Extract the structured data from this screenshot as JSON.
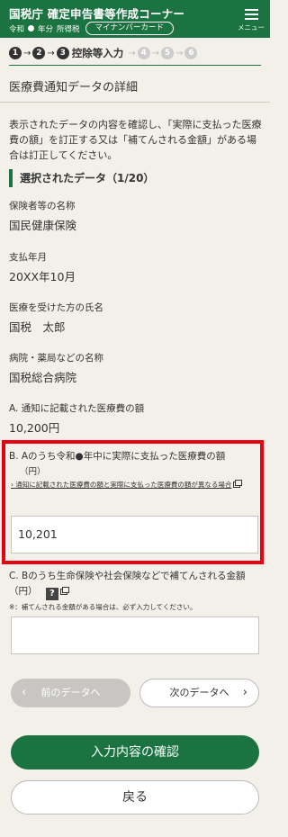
{
  "header": {
    "title": "国税庁 確定申告書等作成コーナー",
    "era": "令和",
    "year_suffix": "年分",
    "tax_type": "所得税",
    "card_label": "マイナンバーカード",
    "menu_label": "メニュー"
  },
  "steps": {
    "items": [
      "1",
      "2",
      "3",
      "4",
      "5",
      "6"
    ],
    "current_label": "控除等入力"
  },
  "page_title": "医療費通知データの詳細",
  "intro": "表示されたデータの内容を確認し、「実際に支払った医療費の額」を訂正する又は「補てんされる金額」がある場合は訂正してください。",
  "section": {
    "title": "選択されたデータ（1/20）"
  },
  "fields": [
    {
      "label": "保険者等の名称",
      "value": "国民健康保険"
    },
    {
      "label": "支払年月",
      "value": "20XX年10月"
    },
    {
      "label": "医療を受けた方の氏名",
      "value": "国税　太郎"
    },
    {
      "label": "病院・薬局などの名称",
      "value": "国税総合病院"
    },
    {
      "label": "A. 通知に記載された医療費の額",
      "value": "10,200円"
    }
  ],
  "field_b": {
    "label": "B. Aのうち令和●年中に実際に支払った医療費の額",
    "unit": "（円）",
    "link": "通知に記載された医療費の額と実際に支払った医療費の額が異なる場合",
    "value": "10,201"
  },
  "field_c": {
    "label": "C. Bのうち生命保険や社会保険などで補てんされる金額（円）",
    "help": "?",
    "note": "※：補てんされる金額がある場合は、必ず入力してください。",
    "value": ""
  },
  "buttons": {
    "prev": "前のデータへ",
    "next": "次のデータへ",
    "confirm": "入力内容の確認",
    "back": "戻る"
  },
  "colors": {
    "brand": "#1b7341",
    "highlight": "#e60012"
  }
}
